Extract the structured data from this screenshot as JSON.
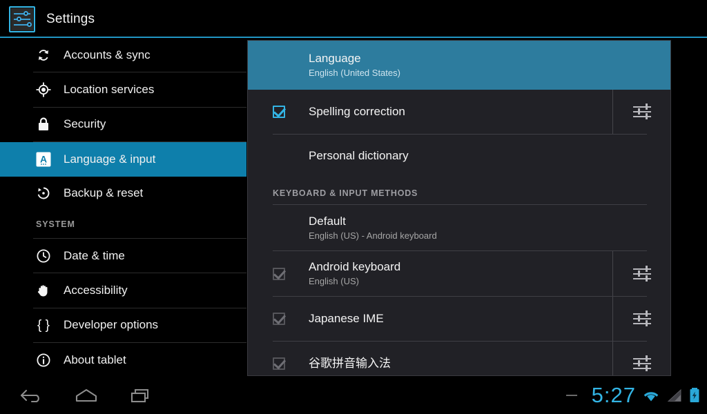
{
  "titlebar": {
    "app_title": "Settings",
    "icon": "settings-sliders-icon",
    "accent_color": "#33b5e5"
  },
  "sidebar": {
    "items": [
      {
        "label": "Accounts & sync",
        "icon": "sync-icon",
        "selected": false
      },
      {
        "label": "Location services",
        "icon": "location-crosshair-icon",
        "selected": false
      },
      {
        "label": "Security",
        "icon": "lock-icon",
        "selected": false
      },
      {
        "label": "Language & input",
        "icon": "language-a-icon",
        "selected": true
      },
      {
        "label": "Backup & reset",
        "icon": "backup-restore-icon",
        "selected": false
      }
    ],
    "section_header": "SYSTEM",
    "system_items": [
      {
        "label": "Date & time",
        "icon": "clock-icon",
        "selected": false
      },
      {
        "label": "Accessibility",
        "icon": "hand-icon",
        "selected": false
      },
      {
        "label": "Developer options",
        "icon": "braces-icon",
        "selected": false
      },
      {
        "label": "About tablet",
        "icon": "info-icon",
        "selected": false
      }
    ],
    "selected_color": "#0e7fab"
  },
  "panel": {
    "highlight_color": "#2d7c9e",
    "rows": [
      {
        "title": "Language",
        "subtitle": "English (United States)",
        "checkbox": "none",
        "settings_icon": false,
        "highlighted": true
      },
      {
        "title": "Spelling correction",
        "subtitle": "",
        "checkbox": "checked",
        "settings_icon": true,
        "highlighted": false
      },
      {
        "title": "Personal dictionary",
        "subtitle": "",
        "checkbox": "none",
        "settings_icon": false,
        "highlighted": false
      }
    ],
    "section_header": "KEYBOARD & INPUT METHODS",
    "keyboard_rows": [
      {
        "title": "Default",
        "subtitle": "English (US) - Android keyboard",
        "checkbox": "none",
        "settings_icon": false
      },
      {
        "title": "Android keyboard",
        "subtitle": "English (US)",
        "checkbox": "dimmed",
        "settings_icon": true
      },
      {
        "title": "Japanese IME",
        "subtitle": "",
        "checkbox": "dimmed",
        "settings_icon": true
      },
      {
        "title": "谷歌拼音输入法",
        "subtitle": "",
        "checkbox": "dimmed",
        "settings_icon": true
      }
    ]
  },
  "navbar": {
    "back_icon": "back-arrow-icon",
    "home_icon": "home-icon",
    "recents_icon": "recent-apps-icon",
    "clock": "5:27",
    "clock_color": "#33b5e5",
    "wifi_icon": "wifi-icon",
    "signal_icon": "signal-icon",
    "battery_icon": "battery-charging-icon"
  }
}
